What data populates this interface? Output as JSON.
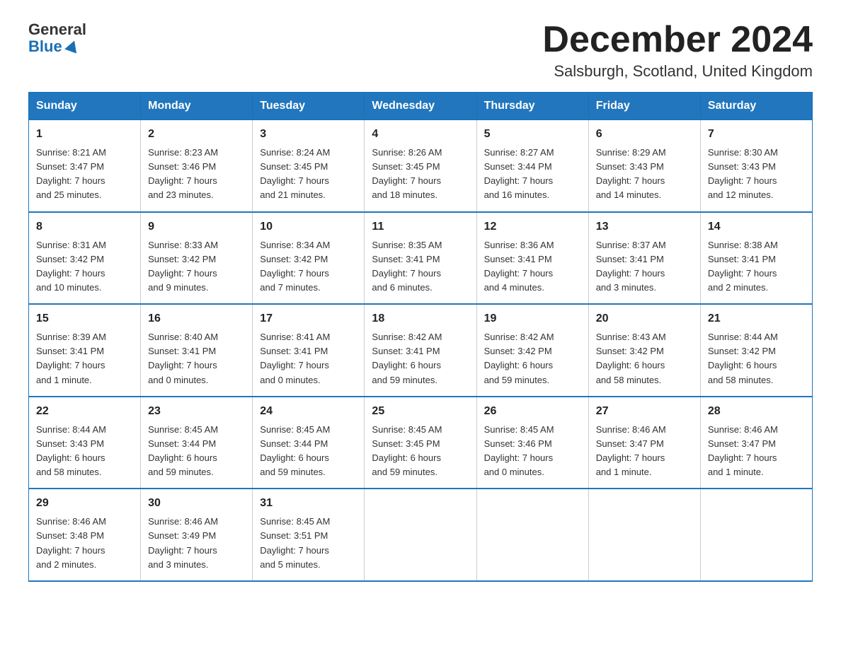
{
  "header": {
    "logo_general": "General",
    "logo_blue": "Blue",
    "month_title": "December 2024",
    "location": "Salsburgh, Scotland, United Kingdom"
  },
  "days_of_week": [
    "Sunday",
    "Monday",
    "Tuesday",
    "Wednesday",
    "Thursday",
    "Friday",
    "Saturday"
  ],
  "weeks": [
    [
      {
        "day": "1",
        "info": "Sunrise: 8:21 AM\nSunset: 3:47 PM\nDaylight: 7 hours\nand 25 minutes."
      },
      {
        "day": "2",
        "info": "Sunrise: 8:23 AM\nSunset: 3:46 PM\nDaylight: 7 hours\nand 23 minutes."
      },
      {
        "day": "3",
        "info": "Sunrise: 8:24 AM\nSunset: 3:45 PM\nDaylight: 7 hours\nand 21 minutes."
      },
      {
        "day": "4",
        "info": "Sunrise: 8:26 AM\nSunset: 3:45 PM\nDaylight: 7 hours\nand 18 minutes."
      },
      {
        "day": "5",
        "info": "Sunrise: 8:27 AM\nSunset: 3:44 PM\nDaylight: 7 hours\nand 16 minutes."
      },
      {
        "day": "6",
        "info": "Sunrise: 8:29 AM\nSunset: 3:43 PM\nDaylight: 7 hours\nand 14 minutes."
      },
      {
        "day": "7",
        "info": "Sunrise: 8:30 AM\nSunset: 3:43 PM\nDaylight: 7 hours\nand 12 minutes."
      }
    ],
    [
      {
        "day": "8",
        "info": "Sunrise: 8:31 AM\nSunset: 3:42 PM\nDaylight: 7 hours\nand 10 minutes."
      },
      {
        "day": "9",
        "info": "Sunrise: 8:33 AM\nSunset: 3:42 PM\nDaylight: 7 hours\nand 9 minutes."
      },
      {
        "day": "10",
        "info": "Sunrise: 8:34 AM\nSunset: 3:42 PM\nDaylight: 7 hours\nand 7 minutes."
      },
      {
        "day": "11",
        "info": "Sunrise: 8:35 AM\nSunset: 3:41 PM\nDaylight: 7 hours\nand 6 minutes."
      },
      {
        "day": "12",
        "info": "Sunrise: 8:36 AM\nSunset: 3:41 PM\nDaylight: 7 hours\nand 4 minutes."
      },
      {
        "day": "13",
        "info": "Sunrise: 8:37 AM\nSunset: 3:41 PM\nDaylight: 7 hours\nand 3 minutes."
      },
      {
        "day": "14",
        "info": "Sunrise: 8:38 AM\nSunset: 3:41 PM\nDaylight: 7 hours\nand 2 minutes."
      }
    ],
    [
      {
        "day": "15",
        "info": "Sunrise: 8:39 AM\nSunset: 3:41 PM\nDaylight: 7 hours\nand 1 minute."
      },
      {
        "day": "16",
        "info": "Sunrise: 8:40 AM\nSunset: 3:41 PM\nDaylight: 7 hours\nand 0 minutes."
      },
      {
        "day": "17",
        "info": "Sunrise: 8:41 AM\nSunset: 3:41 PM\nDaylight: 7 hours\nand 0 minutes."
      },
      {
        "day": "18",
        "info": "Sunrise: 8:42 AM\nSunset: 3:41 PM\nDaylight: 6 hours\nand 59 minutes."
      },
      {
        "day": "19",
        "info": "Sunrise: 8:42 AM\nSunset: 3:42 PM\nDaylight: 6 hours\nand 59 minutes."
      },
      {
        "day": "20",
        "info": "Sunrise: 8:43 AM\nSunset: 3:42 PM\nDaylight: 6 hours\nand 58 minutes."
      },
      {
        "day": "21",
        "info": "Sunrise: 8:44 AM\nSunset: 3:42 PM\nDaylight: 6 hours\nand 58 minutes."
      }
    ],
    [
      {
        "day": "22",
        "info": "Sunrise: 8:44 AM\nSunset: 3:43 PM\nDaylight: 6 hours\nand 58 minutes."
      },
      {
        "day": "23",
        "info": "Sunrise: 8:45 AM\nSunset: 3:44 PM\nDaylight: 6 hours\nand 59 minutes."
      },
      {
        "day": "24",
        "info": "Sunrise: 8:45 AM\nSunset: 3:44 PM\nDaylight: 6 hours\nand 59 minutes."
      },
      {
        "day": "25",
        "info": "Sunrise: 8:45 AM\nSunset: 3:45 PM\nDaylight: 6 hours\nand 59 minutes."
      },
      {
        "day": "26",
        "info": "Sunrise: 8:45 AM\nSunset: 3:46 PM\nDaylight: 7 hours\nand 0 minutes."
      },
      {
        "day": "27",
        "info": "Sunrise: 8:46 AM\nSunset: 3:47 PM\nDaylight: 7 hours\nand 1 minute."
      },
      {
        "day": "28",
        "info": "Sunrise: 8:46 AM\nSunset: 3:47 PM\nDaylight: 7 hours\nand 1 minute."
      }
    ],
    [
      {
        "day": "29",
        "info": "Sunrise: 8:46 AM\nSunset: 3:48 PM\nDaylight: 7 hours\nand 2 minutes."
      },
      {
        "day": "30",
        "info": "Sunrise: 8:46 AM\nSunset: 3:49 PM\nDaylight: 7 hours\nand 3 minutes."
      },
      {
        "day": "31",
        "info": "Sunrise: 8:45 AM\nSunset: 3:51 PM\nDaylight: 7 hours\nand 5 minutes."
      },
      {
        "day": "",
        "info": ""
      },
      {
        "day": "",
        "info": ""
      },
      {
        "day": "",
        "info": ""
      },
      {
        "day": "",
        "info": ""
      }
    ]
  ]
}
